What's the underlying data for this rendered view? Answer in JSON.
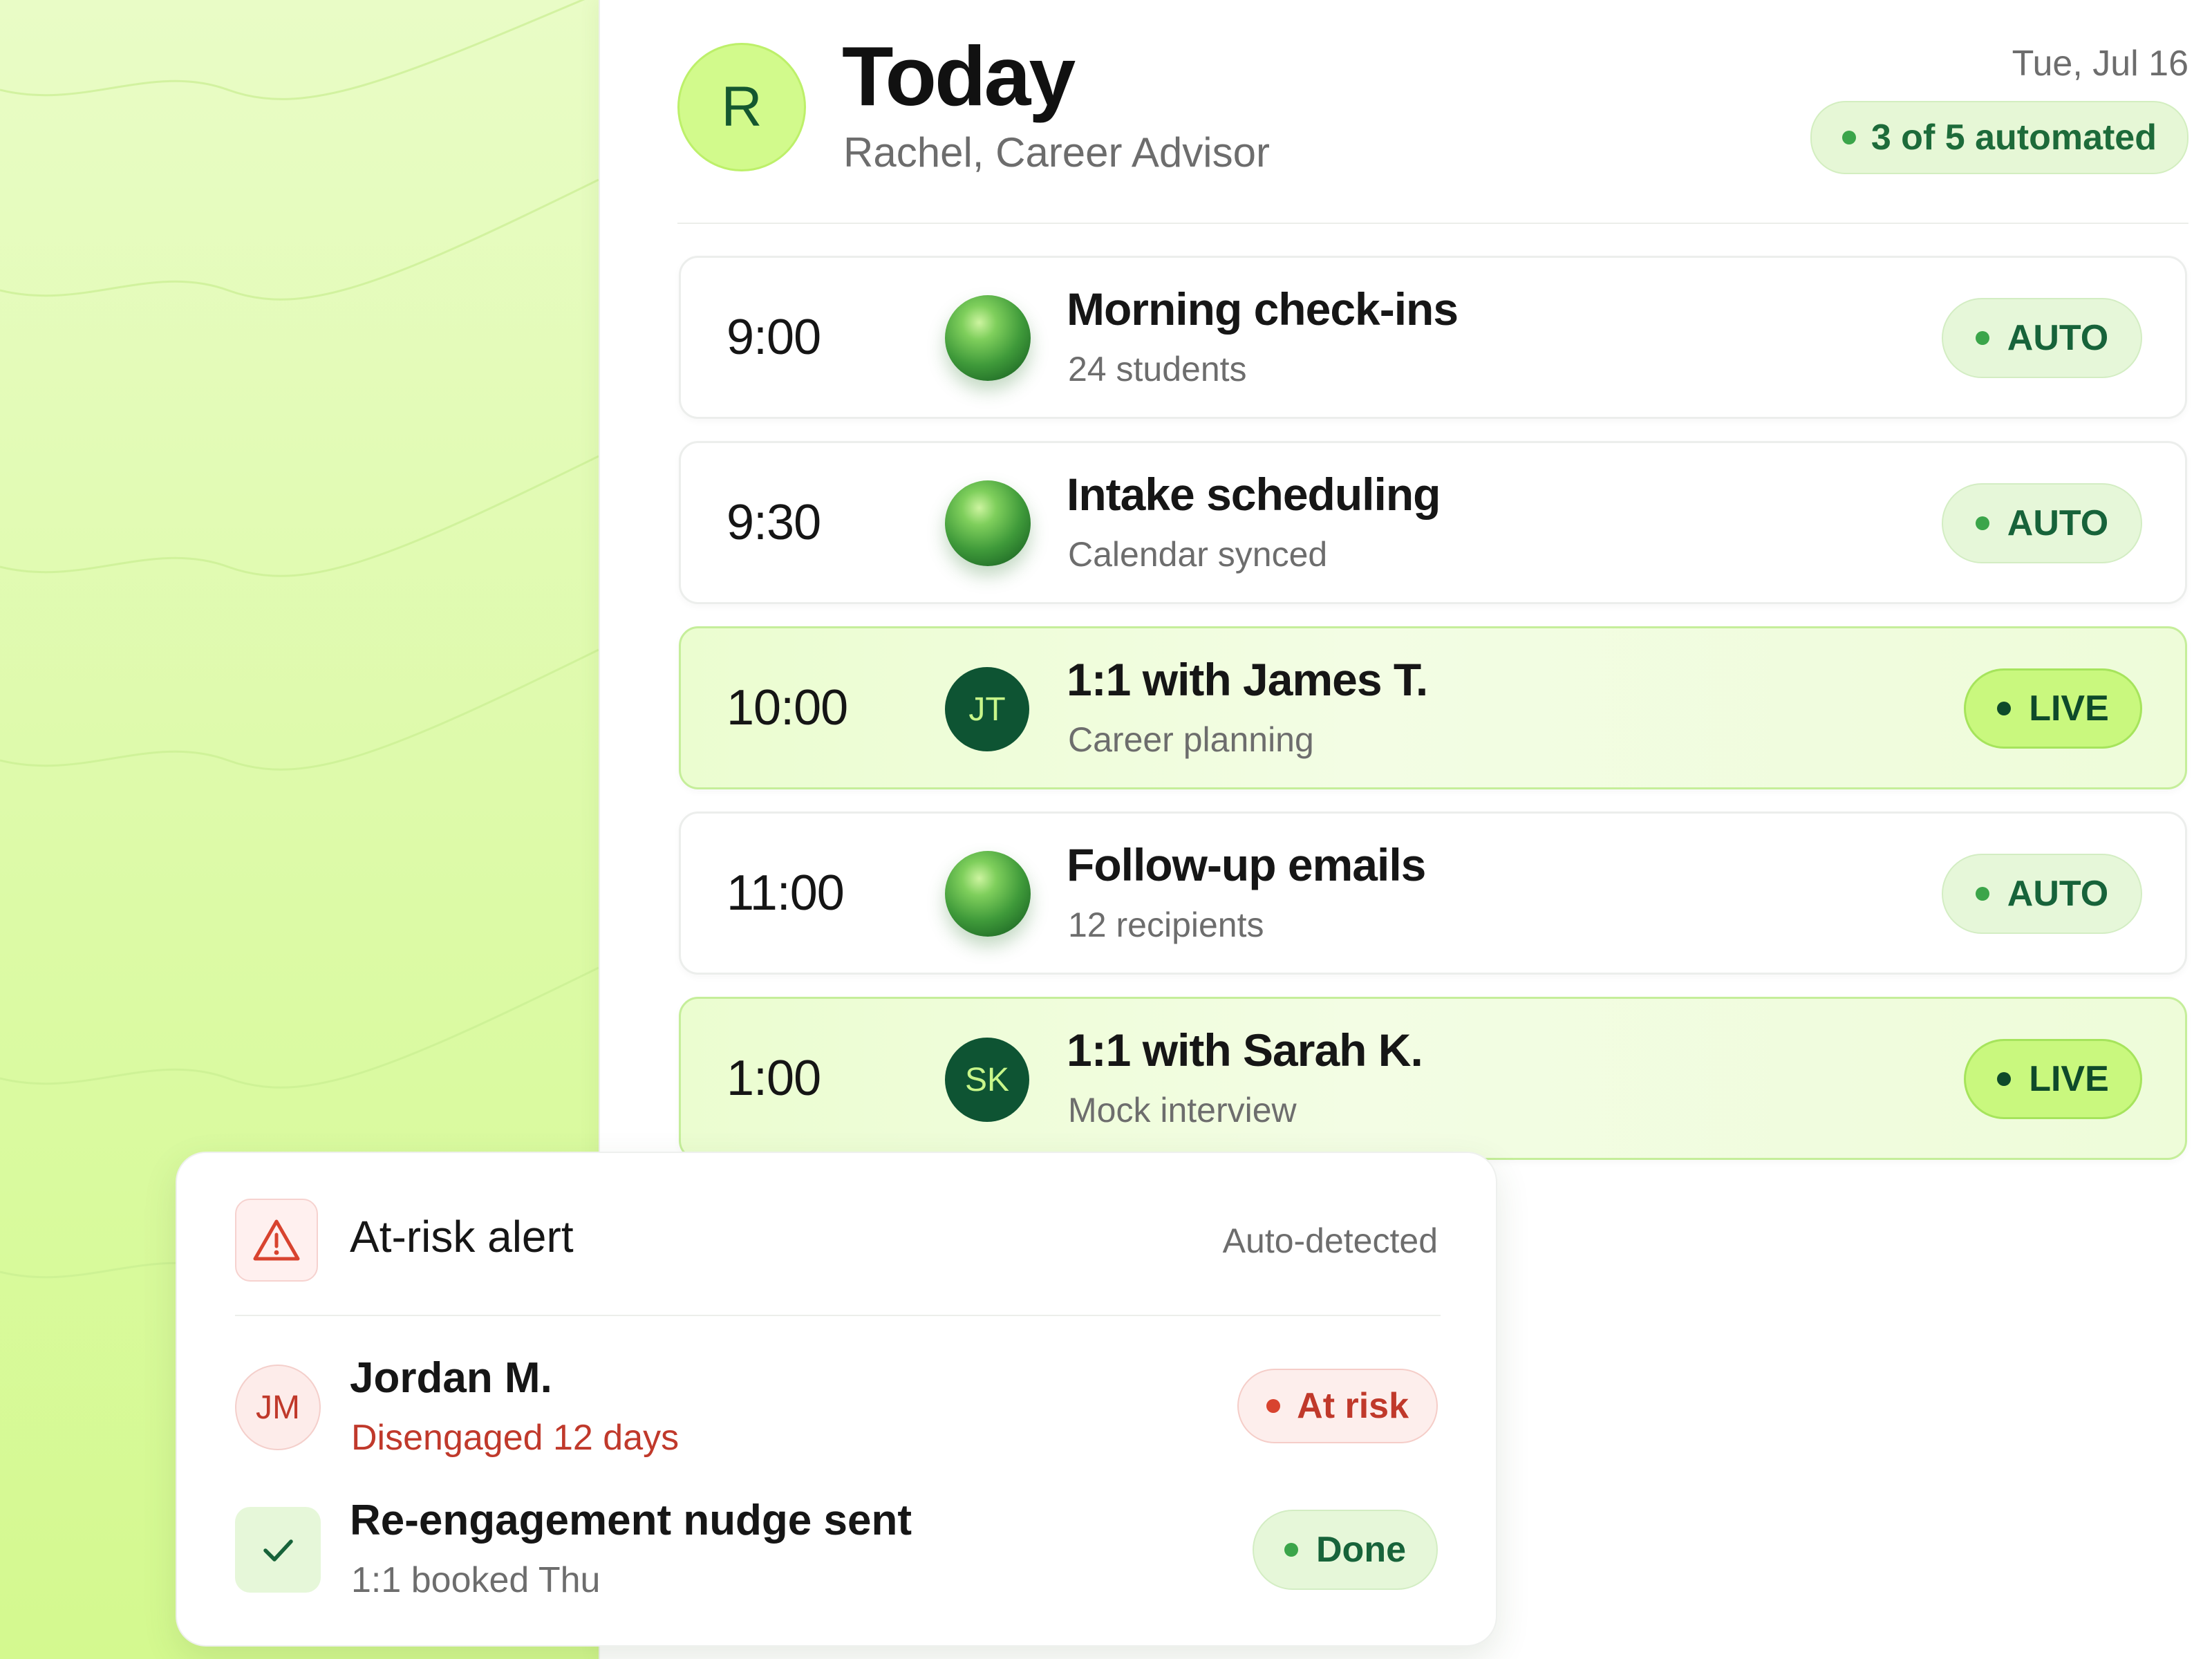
{
  "header": {
    "avatar_initial": "R",
    "title": "Today",
    "subtitle": "Rachel, Career Advisor",
    "date": "Tue, Jul 16",
    "automation_summary": "3 of 5 automated"
  },
  "schedule": [
    {
      "time": "9:00",
      "title": "Morning check-ins",
      "subtitle": "24 students",
      "icon": "green-orb-icon",
      "status": "AUTO"
    },
    {
      "time": "9:30",
      "title": "Intake scheduling",
      "subtitle": "Calendar synced",
      "icon": "green-orb-icon",
      "status": "AUTO"
    },
    {
      "time": "10:00",
      "title": "1:1 with James T.",
      "subtitle": "Career planning",
      "initials": "JT",
      "status": "LIVE"
    },
    {
      "time": "11:00",
      "title": "Follow-up emails",
      "subtitle": "12 recipients",
      "icon": "green-orb-icon",
      "status": "AUTO"
    },
    {
      "time": "1:00",
      "title": "1:1 with Sarah K.",
      "subtitle": "Mock interview",
      "initials": "SK",
      "status": "LIVE"
    }
  ],
  "alert": {
    "icon": "warning-triangle-icon",
    "title": "At-risk alert",
    "tag": "Auto-detected",
    "student": {
      "initials": "JM",
      "name": "Jordan M.",
      "note": "Disengaged 12 days",
      "status": "At risk"
    },
    "action": {
      "icon": "checkmark-icon",
      "title": "Re-engagement nudge sent",
      "note": "1:1 booked Thu",
      "status": "Done"
    }
  },
  "colors": {
    "accent_green": "#3ba54a",
    "live_green": "#c9f87e",
    "dark_green": "#0e5433",
    "alert_red": "#c0392b",
    "background_lime": "#dcfaa6"
  }
}
